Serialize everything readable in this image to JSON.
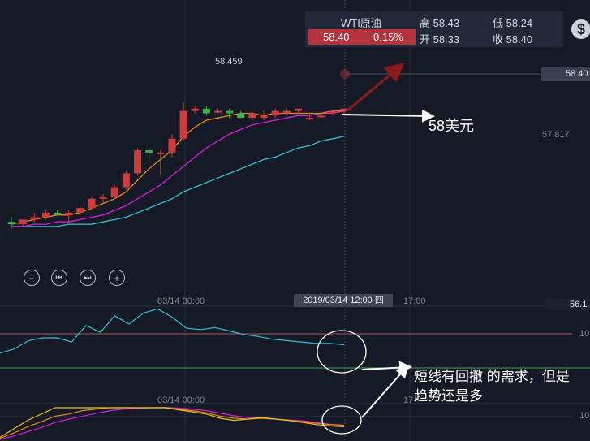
{
  "instrument": {
    "name": "WTI原油",
    "price": "58.40",
    "change_pct": "0.15%",
    "high_label": "高 58.43",
    "low_label": "低 58.24",
    "open_label": "开 58.33",
    "close_label": "收 58.40"
  },
  "axis": {
    "current_price_tag": "58.40",
    "price_level_label": "57.817",
    "time_label_1": "03/14 00:00",
    "time_label_2": "17:00",
    "crosshair_time": "2019/03/14 12:00 四",
    "osc1_right_tag": "56.1",
    "osc1_level": "10",
    "osc2_level": "10",
    "osc2_time_label": "03/14 00:00",
    "osc2_mid_label": "17"
  },
  "controls": {
    "zoom_out": "−",
    "prev": "⏮",
    "next": "⏭",
    "zoom_in": "+"
  },
  "annotations": {
    "target_price": "58美元",
    "comment_line1": "短线有回撤 的需求，但是",
    "comment_line2": "趋势还是多",
    "max_marker": "58.459"
  },
  "colors": {
    "up": "#cf3b3f",
    "down": "#3cb04a",
    "ma_fast": "#e8891c",
    "ma_mid": "#d21fd8",
    "ma_slow": "#2ec3d2",
    "osc_line": "#2ec3d2",
    "osc_level": "#a85a5a",
    "osc_zero": "#38a84a",
    "k_line": "#e8c31c",
    "d_line": "#e8891c",
    "j_line": "#d21fd8",
    "trend_arrow": "#8b1a1a"
  },
  "chart_data": {
    "type": "candlestick",
    "candles": [
      {
        "o": 57.94,
        "h": 57.96,
        "l": 57.91,
        "c": 57.93
      },
      {
        "o": 57.93,
        "h": 57.95,
        "l": 57.92,
        "c": 57.95
      },
      {
        "o": 57.95,
        "h": 57.98,
        "l": 57.94,
        "c": 57.96
      },
      {
        "o": 57.96,
        "h": 57.99,
        "l": 57.95,
        "c": 57.98
      },
      {
        "o": 57.98,
        "h": 57.99,
        "l": 57.97,
        "c": 57.97
      },
      {
        "o": 57.97,
        "h": 57.99,
        "l": 57.94,
        "c": 57.98
      },
      {
        "o": 57.98,
        "h": 58.01,
        "l": 57.97,
        "c": 58.0
      },
      {
        "o": 58.0,
        "h": 58.05,
        "l": 57.99,
        "c": 58.04
      },
      {
        "o": 58.04,
        "h": 58.06,
        "l": 58.02,
        "c": 58.05
      },
      {
        "o": 58.05,
        "h": 58.1,
        "l": 58.04,
        "c": 58.09
      },
      {
        "o": 58.09,
        "h": 58.16,
        "l": 58.08,
        "c": 58.15
      },
      {
        "o": 58.15,
        "h": 58.26,
        "l": 58.14,
        "c": 58.25
      },
      {
        "o": 58.25,
        "h": 58.26,
        "l": 58.2,
        "c": 58.24
      },
      {
        "o": 58.24,
        "h": 58.25,
        "l": 58.14,
        "c": 58.24
      },
      {
        "o": 58.24,
        "h": 58.32,
        "l": 58.22,
        "c": 58.3
      },
      {
        "o": 58.3,
        "h": 58.46,
        "l": 58.29,
        "c": 58.42
      },
      {
        "o": 58.42,
        "h": 58.44,
        "l": 58.41,
        "c": 58.43
      },
      {
        "o": 58.43,
        "h": 58.44,
        "l": 58.4,
        "c": 58.41
      },
      {
        "o": 58.42,
        "h": 58.43,
        "l": 58.41,
        "c": 58.42
      },
      {
        "o": 58.42,
        "h": 58.43,
        "l": 58.39,
        "c": 58.41
      },
      {
        "o": 58.41,
        "h": 58.42,
        "l": 58.39,
        "c": 58.39
      },
      {
        "o": 58.39,
        "h": 58.42,
        "l": 58.38,
        "c": 58.41
      },
      {
        "o": 58.39,
        "h": 58.42,
        "l": 58.38,
        "c": 58.4
      },
      {
        "o": 58.4,
        "h": 58.43,
        "l": 58.39,
        "c": 58.42
      },
      {
        "o": 58.41,
        "h": 58.43,
        "l": 58.4,
        "c": 58.42
      },
      {
        "o": 58.42,
        "h": 58.43,
        "l": 58.41,
        "c": 58.43
      },
      {
        "o": 58.39,
        "h": 58.41,
        "l": 58.38,
        "c": 58.39
      },
      {
        "o": 58.4,
        "h": 58.41,
        "l": 58.39,
        "c": 58.4
      },
      {
        "o": 58.41,
        "h": 58.42,
        "l": 58.4,
        "c": 58.42
      },
      {
        "o": 58.42,
        "h": 58.43,
        "l": 58.4,
        "c": 58.43
      }
    ],
    "ma_fast": [
      57.93,
      57.94,
      57.95,
      57.96,
      57.97,
      57.97,
      57.98,
      58.0,
      58.02,
      58.04,
      58.07,
      58.12,
      58.17,
      58.21,
      58.25,
      58.31,
      58.35,
      58.38,
      58.39,
      58.4,
      58.41,
      58.41,
      58.4,
      58.41,
      58.41,
      58.41,
      58.41,
      58.41,
      58.42,
      58.42
    ],
    "ma_mid": [
      57.92,
      57.92,
      57.93,
      57.93,
      57.94,
      57.94,
      57.95,
      57.96,
      57.97,
      57.99,
      58.01,
      58.04,
      58.07,
      58.1,
      58.14,
      58.18,
      58.22,
      58.26,
      58.29,
      58.32,
      58.34,
      58.36,
      58.37,
      58.38,
      58.39,
      58.4,
      58.4,
      58.41,
      58.41,
      58.42
    ],
    "ma_slow": [
      57.92,
      57.92,
      57.92,
      57.92,
      57.92,
      57.93,
      57.93,
      57.93,
      57.94,
      57.95,
      57.96,
      57.98,
      58.0,
      58.02,
      58.04,
      58.07,
      58.09,
      58.11,
      58.13,
      58.15,
      58.17,
      58.19,
      58.21,
      58.22,
      58.24,
      58.26,
      58.27,
      58.29,
      58.3,
      58.31
    ],
    "osc1": [
      18,
      24,
      36,
      40,
      40,
      34,
      58,
      48,
      72,
      60,
      76,
      82,
      70,
      54,
      52,
      55,
      50,
      45,
      42,
      38,
      36,
      34,
      32,
      32,
      30
    ],
    "osc2_k": [
      5,
      25,
      45,
      60,
      75,
      75,
      75,
      75,
      75,
      75,
      75,
      75,
      75,
      70,
      65,
      60,
      50,
      45,
      48,
      52,
      48,
      45,
      40,
      35,
      32,
      30
    ],
    "osc2_d": [
      3,
      15,
      30,
      42,
      55,
      60,
      68,
      72,
      75,
      75,
      75,
      75,
      75,
      72,
      68,
      63,
      55,
      50,
      48,
      50,
      48,
      45,
      42,
      38,
      35,
      33
    ],
    "osc2_j": [
      0,
      8,
      18,
      28,
      40,
      48,
      55,
      62,
      68,
      72,
      74,
      75,
      76,
      74,
      72,
      68,
      62,
      56,
      52,
      50,
      48,
      46,
      44,
      40,
      36,
      34
    ]
  }
}
